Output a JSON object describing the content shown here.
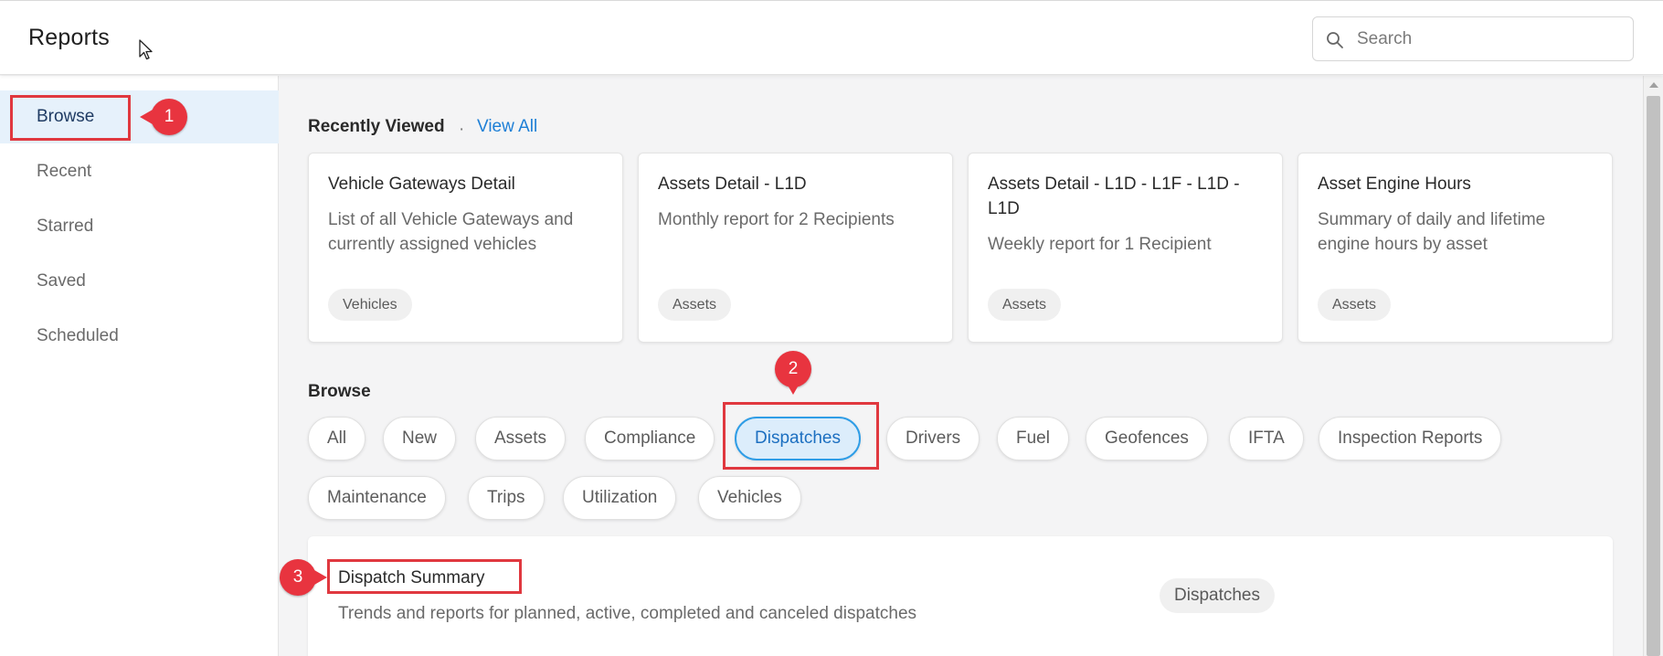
{
  "header": {
    "title": "Reports",
    "search_placeholder": "Search"
  },
  "sidebar": {
    "items": [
      {
        "label": "Browse",
        "active": true
      },
      {
        "label": "Recent"
      },
      {
        "label": "Starred"
      },
      {
        "label": "Saved"
      },
      {
        "label": "Scheduled"
      }
    ]
  },
  "recently_viewed": {
    "heading": "Recently Viewed",
    "separator": "·",
    "view_all": "View All",
    "cards": [
      {
        "title": "Vehicle Gateways Detail",
        "desc": "List of all Vehicle Gateways and currently assigned vehicles",
        "tag": "Vehicles"
      },
      {
        "title": "Assets Detail - L1D",
        "desc": "Monthly report for 2 Recipients",
        "tag": "Assets"
      },
      {
        "title": "Assets Detail - L1D - L1F - L1D - L1D",
        "desc": "Weekly report for 1 Recipient",
        "tag": "Assets"
      },
      {
        "title": "Asset Engine Hours",
        "desc": "Summary of daily and lifetime engine hours by asset",
        "tag": "Assets"
      }
    ]
  },
  "browse": {
    "heading": "Browse",
    "chips": [
      "All",
      "New",
      "Assets",
      "Compliance",
      "Dispatches",
      "Drivers",
      "Fuel",
      "Geofences",
      "IFTA",
      "Inspection Reports",
      "Maintenance",
      "Trips",
      "Utilization",
      "Vehicles"
    ],
    "selected_chip": "Dispatches"
  },
  "result": {
    "title": "Dispatch Summary",
    "desc": "Trends and reports for planned, active, completed and canceled dispatches",
    "tag": "Dispatches"
  },
  "annotations": {
    "marker_1": "1",
    "marker_2": "2",
    "marker_3": "3",
    "color": "#e8343f"
  },
  "colors": {
    "accent": "#1e7fd6",
    "active_sidebar_bg": "#e6f1fb",
    "active_chip_border": "#2f9de6"
  }
}
